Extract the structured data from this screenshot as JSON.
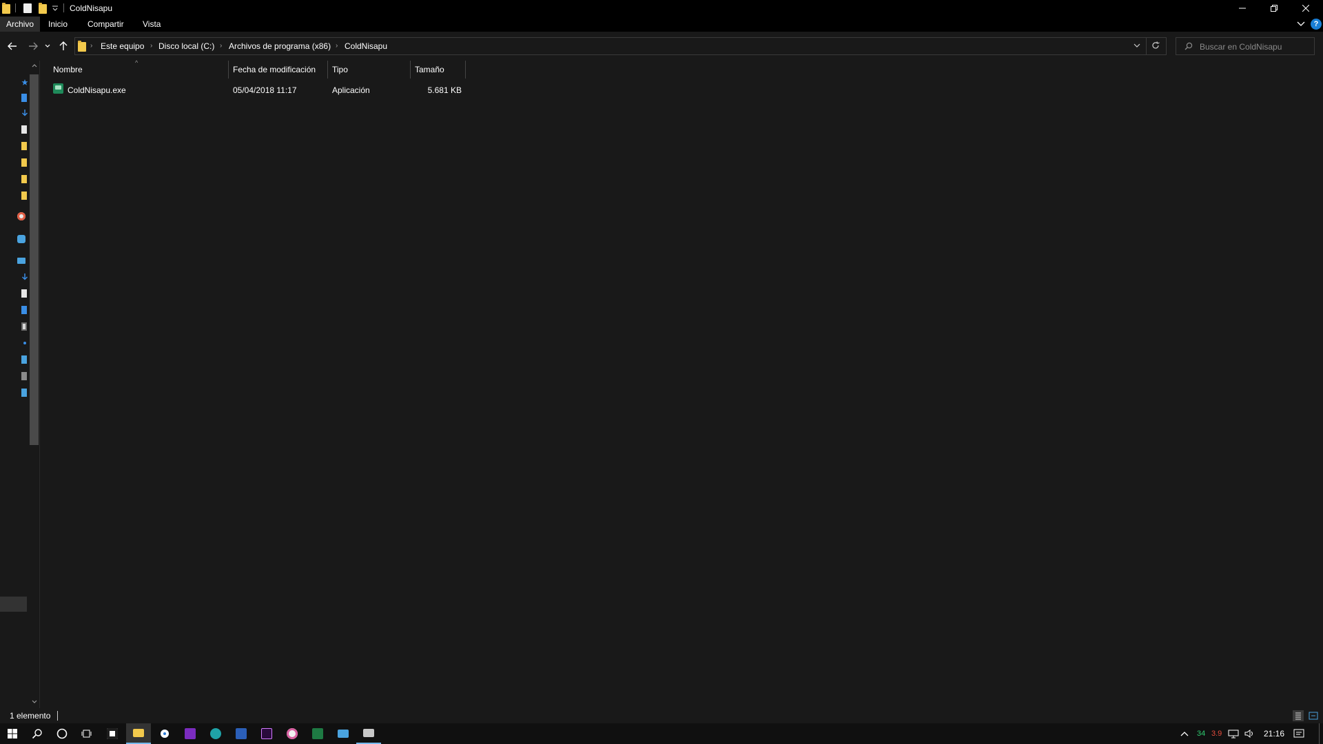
{
  "window": {
    "title": "ColdNisapu"
  },
  "ribbon": {
    "tabs": [
      {
        "label": "Archivo",
        "active": true
      },
      {
        "label": "Inicio",
        "active": false
      },
      {
        "label": "Compartir",
        "active": false
      },
      {
        "label": "Vista",
        "active": false
      }
    ],
    "help_label": "?"
  },
  "address": {
    "breadcrumbs": [
      "Este equipo",
      "Disco local (C:)",
      "Archivos de programa (x86)",
      "ColdNisapu"
    ]
  },
  "search": {
    "placeholder": "Buscar en ColdNisapu"
  },
  "columns": {
    "name": "Nombre",
    "date": "Fecha de modificación",
    "type": "Tipo",
    "size": "Tamaño"
  },
  "files": [
    {
      "name": "ColdNisapu.exe",
      "date": "05/04/2018 11:17",
      "type": "Aplicación",
      "size": "5.681 KB"
    }
  ],
  "status": {
    "count": "1 elemento"
  },
  "tray": {
    "temp_green": "34",
    "temp_red": "3.9",
    "clock": "21:16"
  },
  "colors": {
    "background": "#191919",
    "titlebar": "#000000",
    "folder": "#f2c94c",
    "accent": "#1a7fd6",
    "taskbar_active": "#76b9ed"
  }
}
